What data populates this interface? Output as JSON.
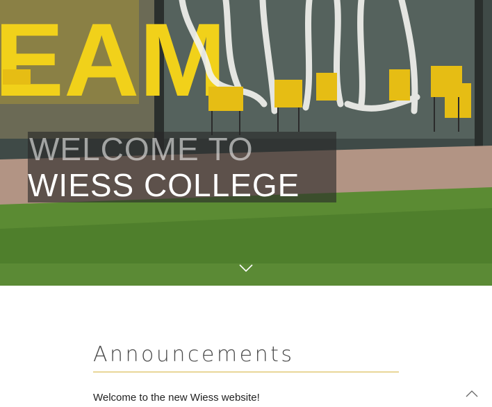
{
  "hero": {
    "line1": "WELCOME TO",
    "line2": "WIESS COLLEGE",
    "banner_text": "EAM",
    "scroll_icon": "chevron-down-icon"
  },
  "announcements": {
    "heading": "Announcements",
    "first_item": "Welcome to the new Wiess website!"
  },
  "controls": {
    "back_to_top_icon": "chevron-up-icon"
  },
  "colors": {
    "accent": "#d4b23c",
    "banner_yellow": "#e8c417",
    "chair_yellow": "#e6bd14",
    "grass": "#5f8a3a"
  }
}
